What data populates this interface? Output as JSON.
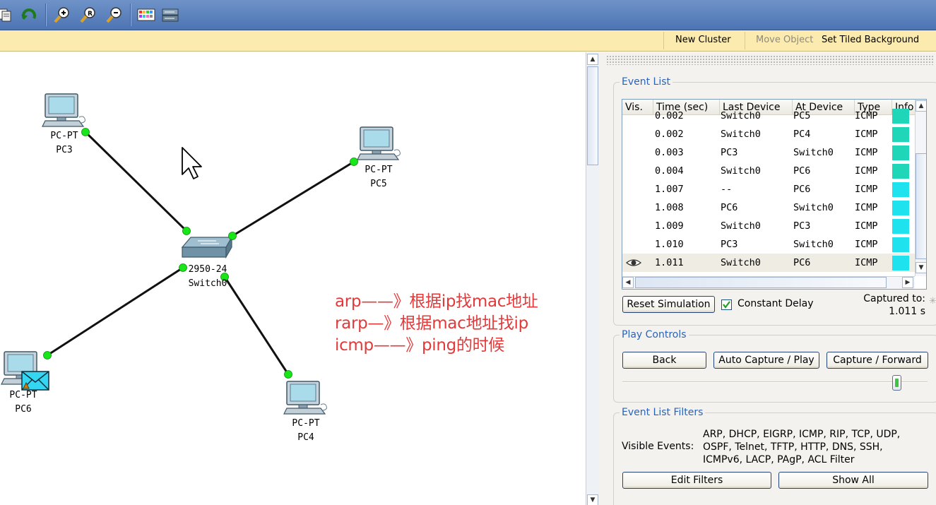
{
  "toolbar": {
    "buttons": [
      "copy-icon",
      "undo-icon",
      "zoom-in-icon",
      "zoom-reset-icon",
      "zoom-out-icon",
      "palette-icon",
      "device-dialog-icon"
    ]
  },
  "logical_bar": {
    "new_cluster": "New Cluster",
    "move_object": "Move Object",
    "set_tiled_background": "Set Tiled Background"
  },
  "topology": {
    "devices": [
      {
        "model": "PC-PT",
        "name": "PC3"
      },
      {
        "model": "PC-PT",
        "name": "PC5"
      },
      {
        "model": "2950-24",
        "name": "Switch0"
      },
      {
        "model": "PC-PT",
        "name": "PC6"
      },
      {
        "model": "PC-PT",
        "name": "PC4"
      }
    ],
    "link_color": "#111111",
    "port_color": "#19e619"
  },
  "notes": {
    "line1": "arp——》根据ip找mac地址",
    "line2": "rarp—》根据mac地址找ip",
    "line3": "icmp——》ping的时候",
    "color": "#e23a3a"
  },
  "event_list": {
    "title": "Event List",
    "columns": [
      "Vis.",
      "Time (sec)",
      "Last Device",
      "At Device",
      "Type",
      "Info"
    ],
    "rows": [
      {
        "time": "0.002",
        "last": "Switch0",
        "at": "PC5",
        "type": "ICMP",
        "color": "#1fd6b8"
      },
      {
        "time": "0.002",
        "last": "Switch0",
        "at": "PC4",
        "type": "ICMP",
        "color": "#1fd6b8"
      },
      {
        "time": "0.003",
        "last": "PC3",
        "at": "Switch0",
        "type": "ICMP",
        "color": "#1fd6b8"
      },
      {
        "time": "0.004",
        "last": "Switch0",
        "at": "PC6",
        "type": "ICMP",
        "color": "#1fd6b8"
      },
      {
        "time": "1.007",
        "last": "--",
        "at": "PC6",
        "type": "ICMP",
        "color": "#1ee2ee"
      },
      {
        "time": "1.008",
        "last": "PC6",
        "at": "Switch0",
        "type": "ICMP",
        "color": "#1ee2ee"
      },
      {
        "time": "1.009",
        "last": "Switch0",
        "at": "PC3",
        "type": "ICMP",
        "color": "#1ee2ee"
      },
      {
        "time": "1.010",
        "last": "PC3",
        "at": "Switch0",
        "type": "ICMP",
        "color": "#1ee2ee"
      },
      {
        "time": "1.011",
        "last": "Switch0",
        "at": "PC6",
        "type": "ICMP",
        "color": "#1ee2ee",
        "current": true
      }
    ],
    "reset_button": "Reset Simulation",
    "constant_delay_label": "Constant Delay",
    "constant_delay_checked": true,
    "captured_to_label": "Captured to:",
    "captured_to_value": "1.011 s"
  },
  "play_controls": {
    "title": "Play Controls",
    "back": "Back",
    "auto_capture": "Auto Capture / Play",
    "capture_forward": "Capture / Forward",
    "speed_level": 0.9
  },
  "filters": {
    "title": "Event List Filters",
    "visible_events_label": "Visible Events:",
    "visible_events_line1": "ARP, DHCP, EIGRP, ICMP, RIP, TCP, UDP,",
    "visible_events_line2": "OSPF, Telnet, TFTP, HTTP, DNS, SSH,",
    "visible_events_line3": "ICMPv6, LACP, PAgP, ACL Filter",
    "edit_filters": "Edit Filters",
    "show_all": "Show All"
  }
}
